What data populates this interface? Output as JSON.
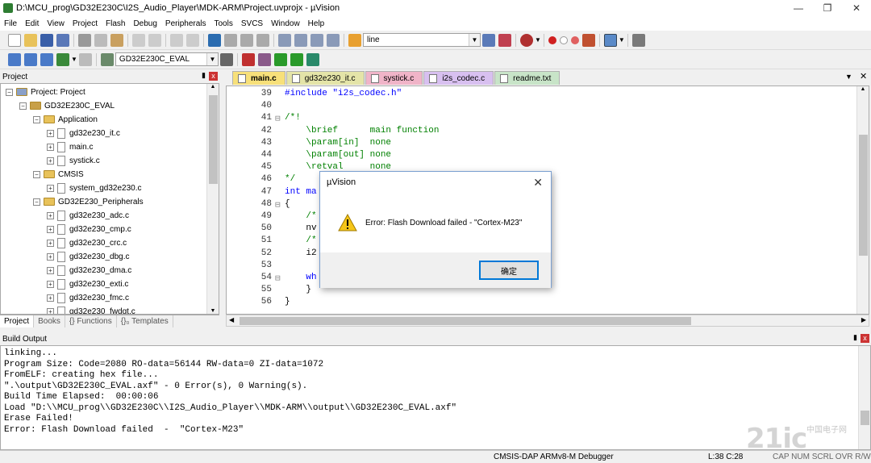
{
  "window": {
    "title": "D:\\MCU_prog\\GD32E230C\\I2S_Audio_Player\\MDK-ARM\\Project.uvprojx - µVision"
  },
  "menu": [
    "File",
    "Edit",
    "View",
    "Project",
    "Flash",
    "Debug",
    "Peripherals",
    "Tools",
    "SVCS",
    "Window",
    "Help"
  ],
  "toolbar": {
    "find_value": "line",
    "target_value": "GD32E230C_EVAL"
  },
  "project_panel": {
    "title": "Project",
    "tree": [
      {
        "label": "Project: Project",
        "level": 0,
        "kind": "project"
      },
      {
        "label": "GD32E230C_EVAL",
        "level": 1,
        "kind": "target"
      },
      {
        "label": "Application",
        "level": 2,
        "kind": "folder"
      },
      {
        "label": "gd32e230_it.c",
        "level": 3,
        "kind": "file"
      },
      {
        "label": "main.c",
        "level": 3,
        "kind": "file"
      },
      {
        "label": "systick.c",
        "level": 3,
        "kind": "file"
      },
      {
        "label": "CMSIS",
        "level": 2,
        "kind": "folder"
      },
      {
        "label": "system_gd32e230.c",
        "level": 3,
        "kind": "file"
      },
      {
        "label": "GD32E230_Peripherals",
        "level": 2,
        "kind": "folder"
      },
      {
        "label": "gd32e230_adc.c",
        "level": 3,
        "kind": "file"
      },
      {
        "label": "gd32e230_cmp.c",
        "level": 3,
        "kind": "file"
      },
      {
        "label": "gd32e230_crc.c",
        "level": 3,
        "kind": "file"
      },
      {
        "label": "gd32e230_dbg.c",
        "level": 3,
        "kind": "file"
      },
      {
        "label": "gd32e230_dma.c",
        "level": 3,
        "kind": "file"
      },
      {
        "label": "gd32e230_exti.c",
        "level": 3,
        "kind": "file"
      },
      {
        "label": "gd32e230_fmc.c",
        "level": 3,
        "kind": "file"
      },
      {
        "label": "gd32e230_fwdgt.c",
        "level": 3,
        "kind": "file"
      }
    ],
    "bottom_tabs": [
      "Project",
      "Books",
      "{} Functions",
      "{}₀ Templates"
    ]
  },
  "editor": {
    "tabs": [
      {
        "label": "main.c",
        "color": "#f7e07a",
        "active": true
      },
      {
        "label": "gd32e230_it.c",
        "color": "#e4e4a8"
      },
      {
        "label": "systick.c",
        "color": "#f0b4c8"
      },
      {
        "label": "i2s_codec.c",
        "color": "#d8c0f0"
      },
      {
        "label": "readme.txt",
        "color": "#c8e4c8"
      }
    ],
    "lines": [
      {
        "n": "39",
        "text": "#include \"i2s_codec.h\""
      },
      {
        "n": "40",
        "text": ""
      },
      {
        "n": "41",
        "text": "/*!"
      },
      {
        "n": "42",
        "text": "    \\brief      main function"
      },
      {
        "n": "43",
        "text": "    \\param[in]  none"
      },
      {
        "n": "44",
        "text": "    \\param[out] none"
      },
      {
        "n": "45",
        "text": "    \\retval     none"
      },
      {
        "n": "46",
        "text": "*/"
      },
      {
        "n": "47",
        "text": "int ma"
      },
      {
        "n": "48",
        "text": "{"
      },
      {
        "n": "49",
        "text": "    /*"
      },
      {
        "n": "50",
        "text": "    nv"
      },
      {
        "n": "51",
        "text": "    /*"
      },
      {
        "n": "52",
        "text": "    i2"
      },
      {
        "n": "53",
        "text": ""
      },
      {
        "n": "54",
        "text": "    wh"
      },
      {
        "n": "55",
        "text": "    }"
      },
      {
        "n": "56",
        "text": "}"
      }
    ]
  },
  "build_output": {
    "title": "Build Output",
    "lines": [
      "linking...",
      "Program Size: Code=2080 RO-data=56144 RW-data=0 ZI-data=1072",
      "FromELF: creating hex file...",
      "\".\\output\\GD32E230C_EVAL.axf\" - 0 Error(s), 0 Warning(s).",
      "Build Time Elapsed:  00:00:06",
      "Load \"D:\\\\MCU_prog\\\\GD32E230C\\\\I2S_Audio_Player\\\\MDK-ARM\\\\output\\\\GD32E230C_EVAL.axf\"",
      "Erase Failed!",
      "Error: Flash Download failed  -  \"Cortex-M23\""
    ]
  },
  "dialog": {
    "title": "µVision",
    "message": "Error: Flash Download failed  -  \"Cortex-M23\"",
    "ok_label": "确定"
  },
  "status": {
    "debugger": "CMSIS-DAP ARMv8-M Debugger",
    "position": "L:38 C:28",
    "flags": "CAP  NUM  SCRL  OVR  R/W"
  },
  "watermark": {
    "text": "21ic",
    "sub": "中国电子网"
  }
}
